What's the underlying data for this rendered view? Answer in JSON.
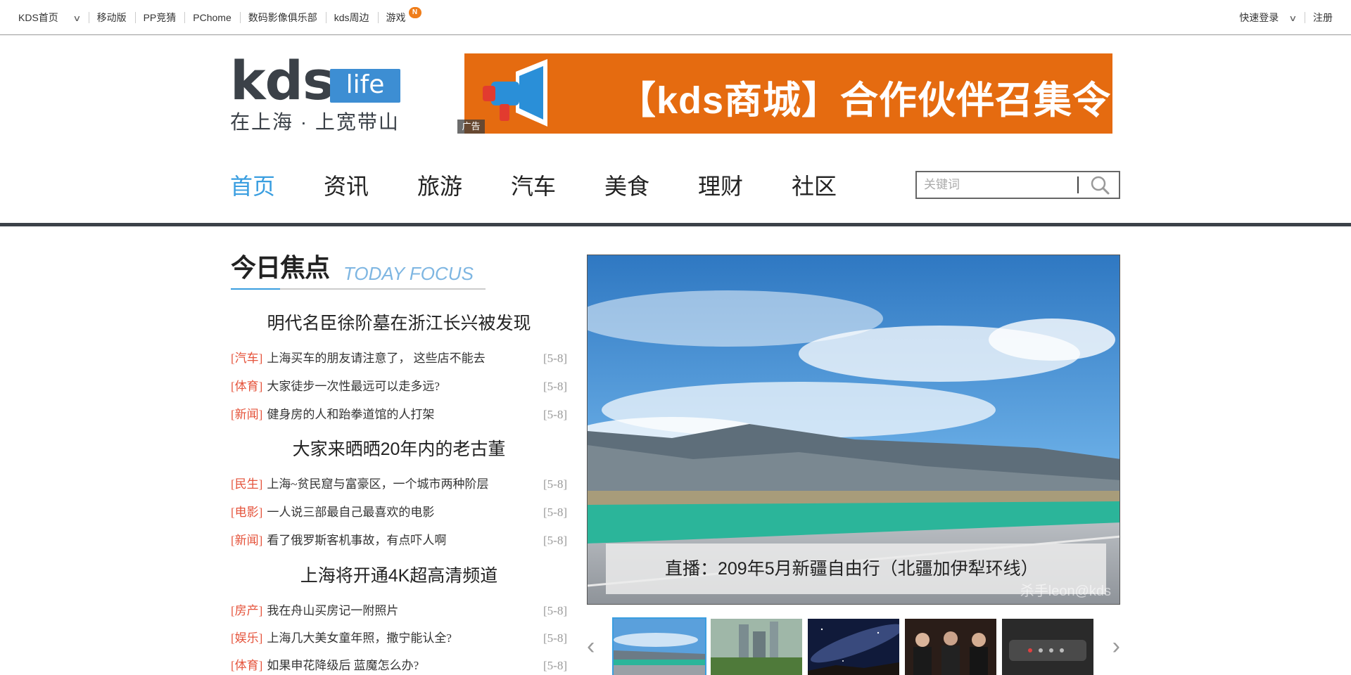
{
  "topbar": {
    "left": [
      {
        "label": "KDS首页",
        "dropdown": true
      },
      {
        "label": "移动版"
      },
      {
        "label": "PP竞猜"
      },
      {
        "label": "PChome"
      },
      {
        "label": "数码影像俱乐部"
      },
      {
        "label": "kds周边"
      },
      {
        "label": "游戏",
        "badge": "N"
      }
    ],
    "right": [
      {
        "label": "快速登录",
        "dropdown": true
      },
      {
        "label": "注册"
      }
    ]
  },
  "logo": {
    "main": "kds",
    "badge": "life",
    "slogan": "在上海 · 上宽带山"
  },
  "ad": {
    "text": "【kds商城】合作伙伴召集令",
    "tag": "广告",
    "color": "#e56b10"
  },
  "nav": {
    "items": [
      "首页",
      "资讯",
      "旅游",
      "汽车",
      "美食",
      "理财",
      "社区"
    ],
    "active": "首页",
    "active_color": "#3a9ee0"
  },
  "search": {
    "placeholder": "关键词",
    "value": "",
    "icon": "search-icon"
  },
  "focus": {
    "title_cn": "今日焦点",
    "title_en": "TODAY FOCUS",
    "groups": [
      {
        "headline": "明代名臣徐阶墓在浙江长兴被发现",
        "items": [
          {
            "category": "[汽车]",
            "title": "上海买车的朋友请注意了， 这些店不能去",
            "date": "[5-8]"
          },
          {
            "category": "[体育]",
            "title": "大家徒步一次性最远可以走多远?",
            "date": "[5-8]"
          },
          {
            "category": "[新闻]",
            "title": "健身房的人和跆拳道馆的人打架",
            "date": "[5-8]"
          }
        ]
      },
      {
        "headline": "大家来晒晒20年内的老古董",
        "items": [
          {
            "category": "[民生]",
            "title": "上海~贫民窟与富豪区，一个城市两种阶层",
            "date": "[5-8]"
          },
          {
            "category": "[电影]",
            "title": "一人说三部最自己最喜欢的电影",
            "date": "[5-8]"
          },
          {
            "category": "[新闻]",
            "title": "看了俄罗斯客机事故，有点吓人啊",
            "date": "[5-8]"
          }
        ]
      },
      {
        "headline": "上海将开通4K超高清频道",
        "items": [
          {
            "category": "[房产]",
            "title": "我在舟山买房记一附照片",
            "date": "[5-8]"
          },
          {
            "category": "[娱乐]",
            "title": "上海几大美女童年照，撒宁能认全?",
            "date": "[5-8]"
          },
          {
            "category": "[体育]",
            "title": "如果申花降级后 蓝魔怎么办?",
            "date": "[5-8]"
          }
        ]
      }
    ]
  },
  "slider": {
    "caption": "直播：209年5月新疆自由行（北疆加伊犁环线）",
    "watermark": "杀手leon@kds",
    "prev_icon": "chevron-left-icon",
    "next_icon": "chevron-right-icon"
  }
}
